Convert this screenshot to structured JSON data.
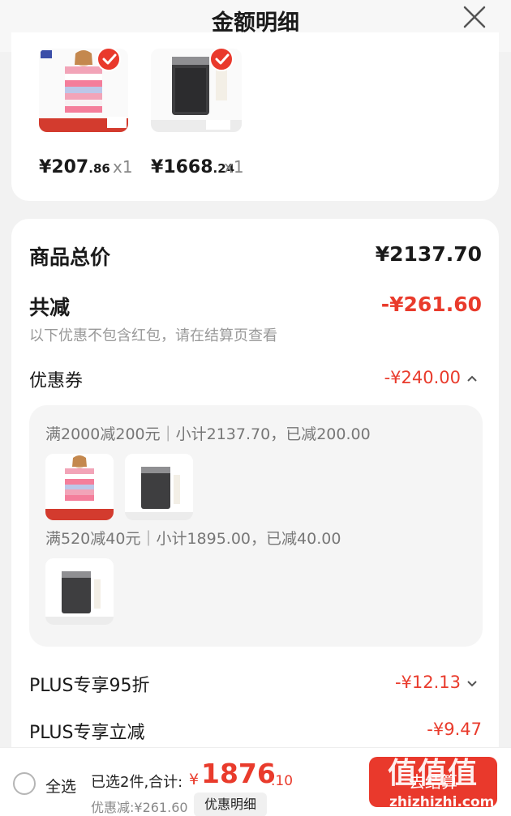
{
  "header": {
    "title": "金额明细"
  },
  "products": [
    {
      "currency": "¥",
      "price_int": "207",
      "price_dec": ".86",
      "qty": "x1",
      "kind": "sweater"
    },
    {
      "currency": "¥",
      "price_int": "1668",
      "price_dec": ".24",
      "qty": "x1",
      "kind": "purifier"
    }
  ],
  "summary": {
    "total_label": "商品总价",
    "total_value": "¥2137.70",
    "reduce_label": "共减",
    "reduce_value": "-¥261.60",
    "note": "以下优惠不包含红包，请在结算页查看",
    "coupon_label": "优惠券",
    "coupon_value": "-¥240.00"
  },
  "coupon_rules": [
    {
      "text": "满2000减200元｜小计2137.70，已减200.00"
    },
    {
      "text": "满520减40元｜小计1895.00，已减40.00"
    }
  ],
  "plus": [
    {
      "label": "PLUS专享95折",
      "value": "-¥12.13"
    },
    {
      "label": "PLUS专享立减",
      "value": "-¥9.47"
    }
  ],
  "bottom": {
    "select_all": "全选",
    "summary_text": "已选2件,合计:",
    "total_currency": "¥",
    "total_int": "1876",
    "total_dec": ".10",
    "discount_text": "优惠减:¥261.60",
    "detail_button": "优惠明细",
    "checkout_button": "去结算"
  },
  "watermark": {
    "main": "值值值",
    "sub": "zhizhizhi.com"
  },
  "colors": {
    "accent": "#e9392c",
    "background": "#f2f2f2",
    "panel": "#f5f5f5"
  }
}
